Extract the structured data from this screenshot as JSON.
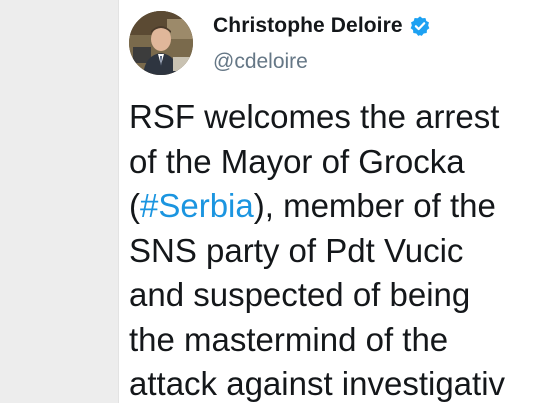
{
  "tweet": {
    "author": {
      "display_name": "Christophe Deloire",
      "handle": "@cdeloire",
      "verified": true,
      "avatar_icon": "profile-photo"
    },
    "text_lines": {
      "l1": "RSF welcomes the arrest",
      "l2": "of the Mayor of Grocka",
      "l3_open": "(",
      "l3_hashtag": "#Serbia",
      "l3_rest": "), member of the",
      "l4": "SNS party of Pdt Vucic",
      "l5": "and suspected of being",
      "l6": "the mastermind of the",
      "l7": "attack against investigativ"
    }
  },
  "colors": {
    "background": "#ededed",
    "card": "#ffffff",
    "text": "#14171a",
    "handle": "#657786",
    "hashtag": "#1b95e0",
    "verified_badge": "#1da1f2"
  }
}
